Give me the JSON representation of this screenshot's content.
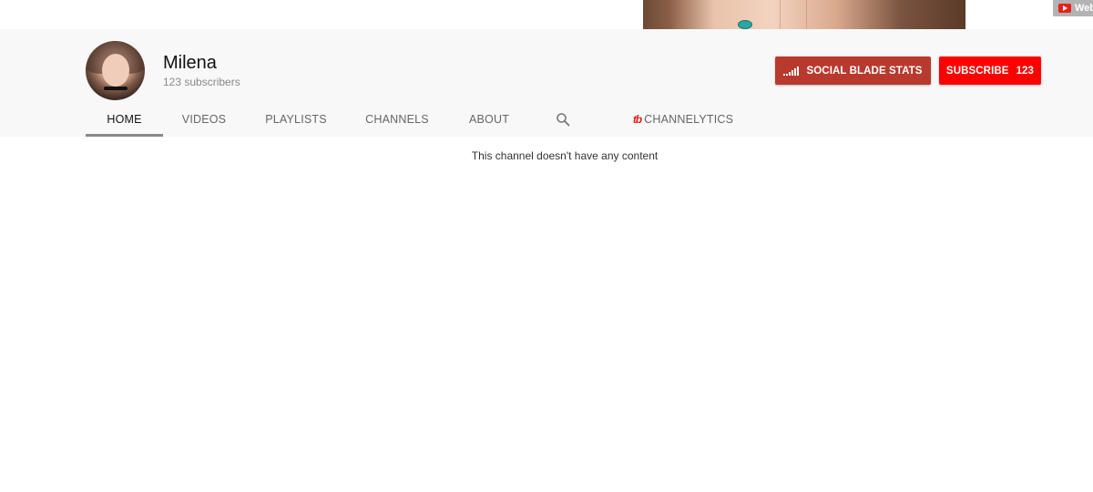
{
  "banner": {
    "link_label": "Web"
  },
  "channel": {
    "name": "Milena",
    "subscribers": "123 subscribers"
  },
  "buttons": {
    "social_blade": "SOCIAL BLADE STATS",
    "subscribe": "SUBSCRIBE",
    "subscribe_count": "123"
  },
  "tabs": [
    {
      "label": "HOME",
      "active": true
    },
    {
      "label": "VIDEOS"
    },
    {
      "label": "PLAYLISTS"
    },
    {
      "label": "CHANNELS"
    },
    {
      "label": "ABOUT"
    },
    {
      "icon": "search-icon"
    },
    {
      "logo": "tb",
      "label": "CHANNELYTICS"
    }
  ],
  "content": {
    "empty_message": "This channel doesn't have any content"
  },
  "colors": {
    "header_bg": "#f8f8f8",
    "social_blade_button": "#b8392e",
    "subscribe_button": "#ff0000",
    "tubebuddy_logo": "#e62117"
  }
}
